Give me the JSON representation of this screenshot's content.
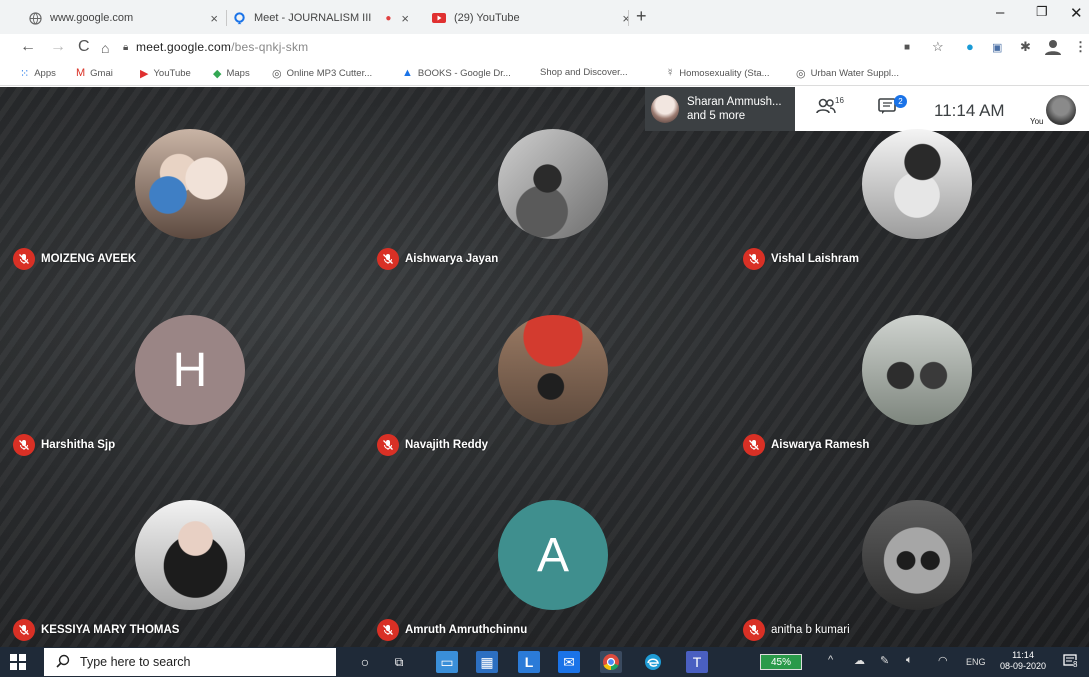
{
  "browser": {
    "tabs": [
      {
        "label": "www.google.com",
        "icon": "globe-icon"
      },
      {
        "label": "Meet - JOURNALISM III",
        "icon": "meet-icon"
      },
      {
        "label": "(29) YouTube",
        "icon": "youtube-icon"
      }
    ],
    "url_host": "meet.google.com",
    "url_path": "/bes-qnkj-skm",
    "bookmarks": [
      {
        "label": "Apps",
        "icon": "apps-grid-icon"
      },
      {
        "label": "Gmai",
        "icon": "gmail-icon"
      },
      {
        "label": "YouTube",
        "icon": "youtube-icon"
      },
      {
        "label": "Maps",
        "icon": "maps-icon"
      },
      {
        "label": "Online MP3 Cutter...",
        "icon": "globe-icon"
      },
      {
        "label": "BOOKS - Google Dr...",
        "icon": "drive-icon"
      },
      {
        "label": "Shop and Discover...",
        "icon": ""
      },
      {
        "label": "Homosexuality (Sta...",
        "icon": "bookmark-icon"
      },
      {
        "label": "Urban Water Suppl...",
        "icon": "globe-icon"
      }
    ]
  },
  "meet": {
    "presenter_line1": "Sharan Ammush...",
    "presenter_line2": "and 5 more",
    "participant_count": "16",
    "chat_badge": "2",
    "clock": "11:14 AM",
    "you_label": "You",
    "participants": [
      {
        "name": "MOIZENG AVEEK",
        "muted": true,
        "avatar": "photo"
      },
      {
        "name": "Aishwarya Jayan",
        "muted": true,
        "avatar": "photo"
      },
      {
        "name": "Vishal Laishram",
        "muted": true,
        "avatar": "photo"
      },
      {
        "name": "Harshitha Sjp",
        "muted": true,
        "avatar": "letter",
        "letter": "H",
        "color": "#9a8585"
      },
      {
        "name": "Navajith Reddy",
        "muted": true,
        "avatar": "photo"
      },
      {
        "name": "Aiswarya Ramesh",
        "muted": true,
        "avatar": "photo"
      },
      {
        "name": "KESSIYA MARY THOMAS",
        "muted": true,
        "avatar": "photo"
      },
      {
        "name": "Amruth Amruthchinnu",
        "muted": true,
        "avatar": "letter",
        "letter": "A",
        "color": "#3f8f8e"
      },
      {
        "name": "anitha b kumari",
        "muted": true,
        "avatar": "photo"
      }
    ]
  },
  "taskbar": {
    "search_placeholder": "Type here to search",
    "battery": "45%",
    "language": "ENG",
    "time": "11:14",
    "date": "08-09-2020",
    "notification_count": "8"
  },
  "colors": {
    "muted_mic": "#d93025",
    "meet_bg": "#2a2c2e",
    "taskbar": "#1f2a38"
  }
}
